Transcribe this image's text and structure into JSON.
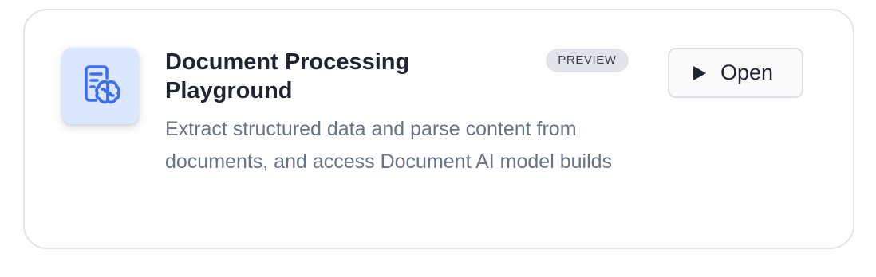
{
  "card": {
    "title": "Document Processing Playground",
    "badge": "PREVIEW",
    "description": "Extract structured data and parse content from documents, and access Document AI model builds",
    "icon": "document-brain-icon",
    "open_button": {
      "label": "Open",
      "icon": "play-icon"
    }
  },
  "colors": {
    "accent": "#3b6ff0",
    "icon_tile_bg": "#dbe7fe",
    "title": "#1f2430",
    "description": "#687386",
    "badge_bg": "#e2e4ea",
    "border": "#e2e4e8"
  }
}
